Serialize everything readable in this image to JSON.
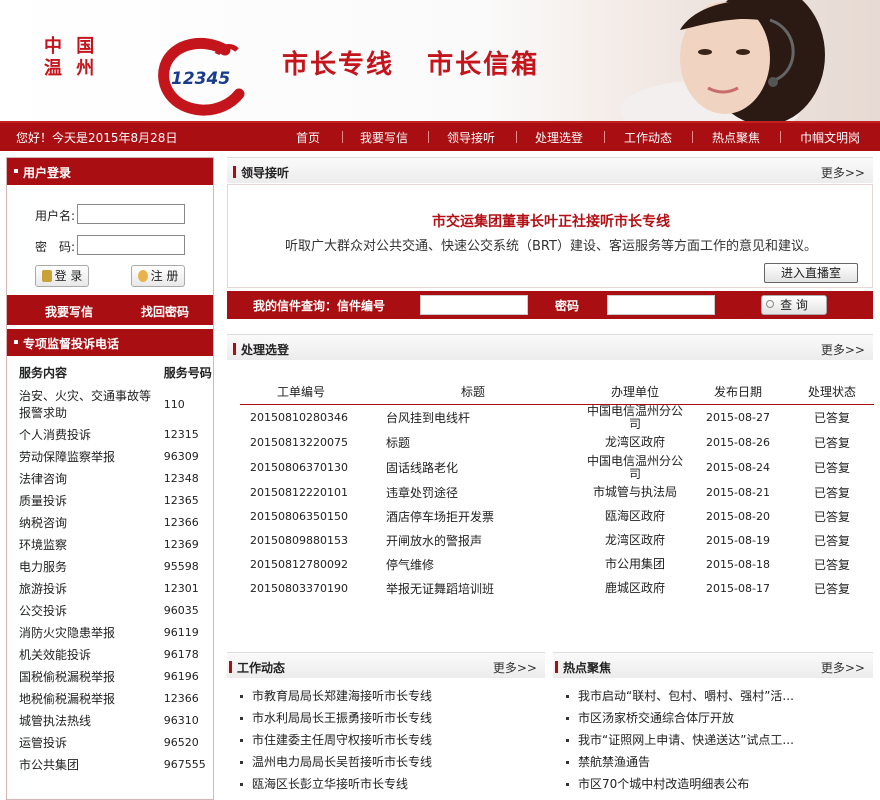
{
  "banner": {
    "city_line1": "中 国",
    "city_line2": "温 州",
    "logo_text": "12345",
    "slogan": "市长专线   市长信箱"
  },
  "nav": {
    "greeting": "您好！今天是2015年8月28日",
    "items": [
      "首页",
      "我要写信",
      "领导接听",
      "处理选登",
      "工作动态",
      "热点聚焦",
      "巾帼文明岗"
    ]
  },
  "login": {
    "title": "用户登录",
    "username_label": "用户名:",
    "password_label": "密　码:",
    "login_button": "登 录",
    "register_button": "注 册",
    "write_letter": "我要写信",
    "retrieve_password": "找回密码"
  },
  "hotlines": {
    "title": "专项监督投诉电话",
    "col_content": "服务内容",
    "col_number": "服务号码",
    "rows": [
      {
        "name": "治安、火灾、交通事故等报警求助",
        "number": "110"
      },
      {
        "name": "个人消费投诉",
        "number": "12315"
      },
      {
        "name": "劳动保障监察举报",
        "number": "96309"
      },
      {
        "name": "法律咨询",
        "number": "12348"
      },
      {
        "name": "质量投诉",
        "number": "12365"
      },
      {
        "name": "纳税咨询",
        "number": "12366"
      },
      {
        "name": "环境监察",
        "number": "12369"
      },
      {
        "name": "电力服务",
        "number": "95598"
      },
      {
        "name": "旅游投诉",
        "number": "12301"
      },
      {
        "name": "公交投诉",
        "number": "96035"
      },
      {
        "name": "消防火灾隐患举报",
        "number": "96119"
      },
      {
        "name": "机关效能投诉",
        "number": "96178"
      },
      {
        "name": "国税偷税漏税举报",
        "number": "96196"
      },
      {
        "name": "地税偷税漏税举报",
        "number": "12366"
      },
      {
        "name": "城管执法热线",
        "number": "96310"
      },
      {
        "name": "运管投诉",
        "number": "96520"
      },
      {
        "name": "市公共集团",
        "number": "967555"
      }
    ]
  },
  "leader": {
    "title": "领导接听",
    "more": "更多>>",
    "headline": "市交运集团董事长叶正社接听市长专线",
    "desc": "听取广大群众对公共交通、快速公交系统（BRT）建设、客运服务等方面工作的意见和建议。",
    "live_button": "进入直播室"
  },
  "query": {
    "letter_label": "我的信件查询：信件编号",
    "password_label": "密码",
    "button": "查 询"
  },
  "processing": {
    "title": "处理选登",
    "more": "更多>>",
    "headers": [
      "工单编号",
      "标题",
      "办理单位",
      "发布日期",
      "处理状态"
    ],
    "rows": [
      {
        "id": "20150810280346",
        "title": "台风挂到电线杆",
        "unit": "中国电信温州分公司",
        "date": "2015-08-27",
        "status": "已答复"
      },
      {
        "id": "20150813220075",
        "title": "标题",
        "unit": "龙湾区政府",
        "date": "2015-08-26",
        "status": "已答复"
      },
      {
        "id": "20150806370130",
        "title": "固话线路老化",
        "unit": "中国电信温州分公司",
        "date": "2015-08-24",
        "status": "已答复"
      },
      {
        "id": "20150812220101",
        "title": "违章处罚途径",
        "unit": "市城管与执法局",
        "date": "2015-08-21",
        "status": "已答复"
      },
      {
        "id": "20150806350150",
        "title": "酒店停车场拒开发票",
        "unit": "瓯海区政府",
        "date": "2015-08-20",
        "status": "已答复"
      },
      {
        "id": "20150809880153",
        "title": "开闸放水的警报声",
        "unit": "龙湾区政府",
        "date": "2015-08-19",
        "status": "已答复"
      },
      {
        "id": "20150812780092",
        "title": "停气维修",
        "unit": "市公用集团",
        "date": "2015-08-18",
        "status": "已答复"
      },
      {
        "id": "20150803370190",
        "title": "举报无证舞蹈培训班",
        "unit": "鹿城区政府",
        "date": "2015-08-17",
        "status": "已答复"
      }
    ]
  },
  "work": {
    "title": "工作动态",
    "more": "更多>>",
    "items": [
      "市教育局局长郑建海接听市长专线",
      "市水利局局长王振勇接听市长专线",
      "市住建委主任周守权接听市长专线",
      "温州电力局局长吴哲接听市长专线",
      "瓯海区长彭立华接听市长专线"
    ]
  },
  "hot": {
    "title": "热点聚焦",
    "more": "更多>>",
    "items": [
      "我市启动“联村、包村、嚼村、强村”活...",
      "市区汤家桥交通综合体厅开放",
      "我市“证照网上申请、快递送达”试点工...",
      "禁航禁渔通告",
      "市区70个城中村改造明细表公布"
    ]
  }
}
